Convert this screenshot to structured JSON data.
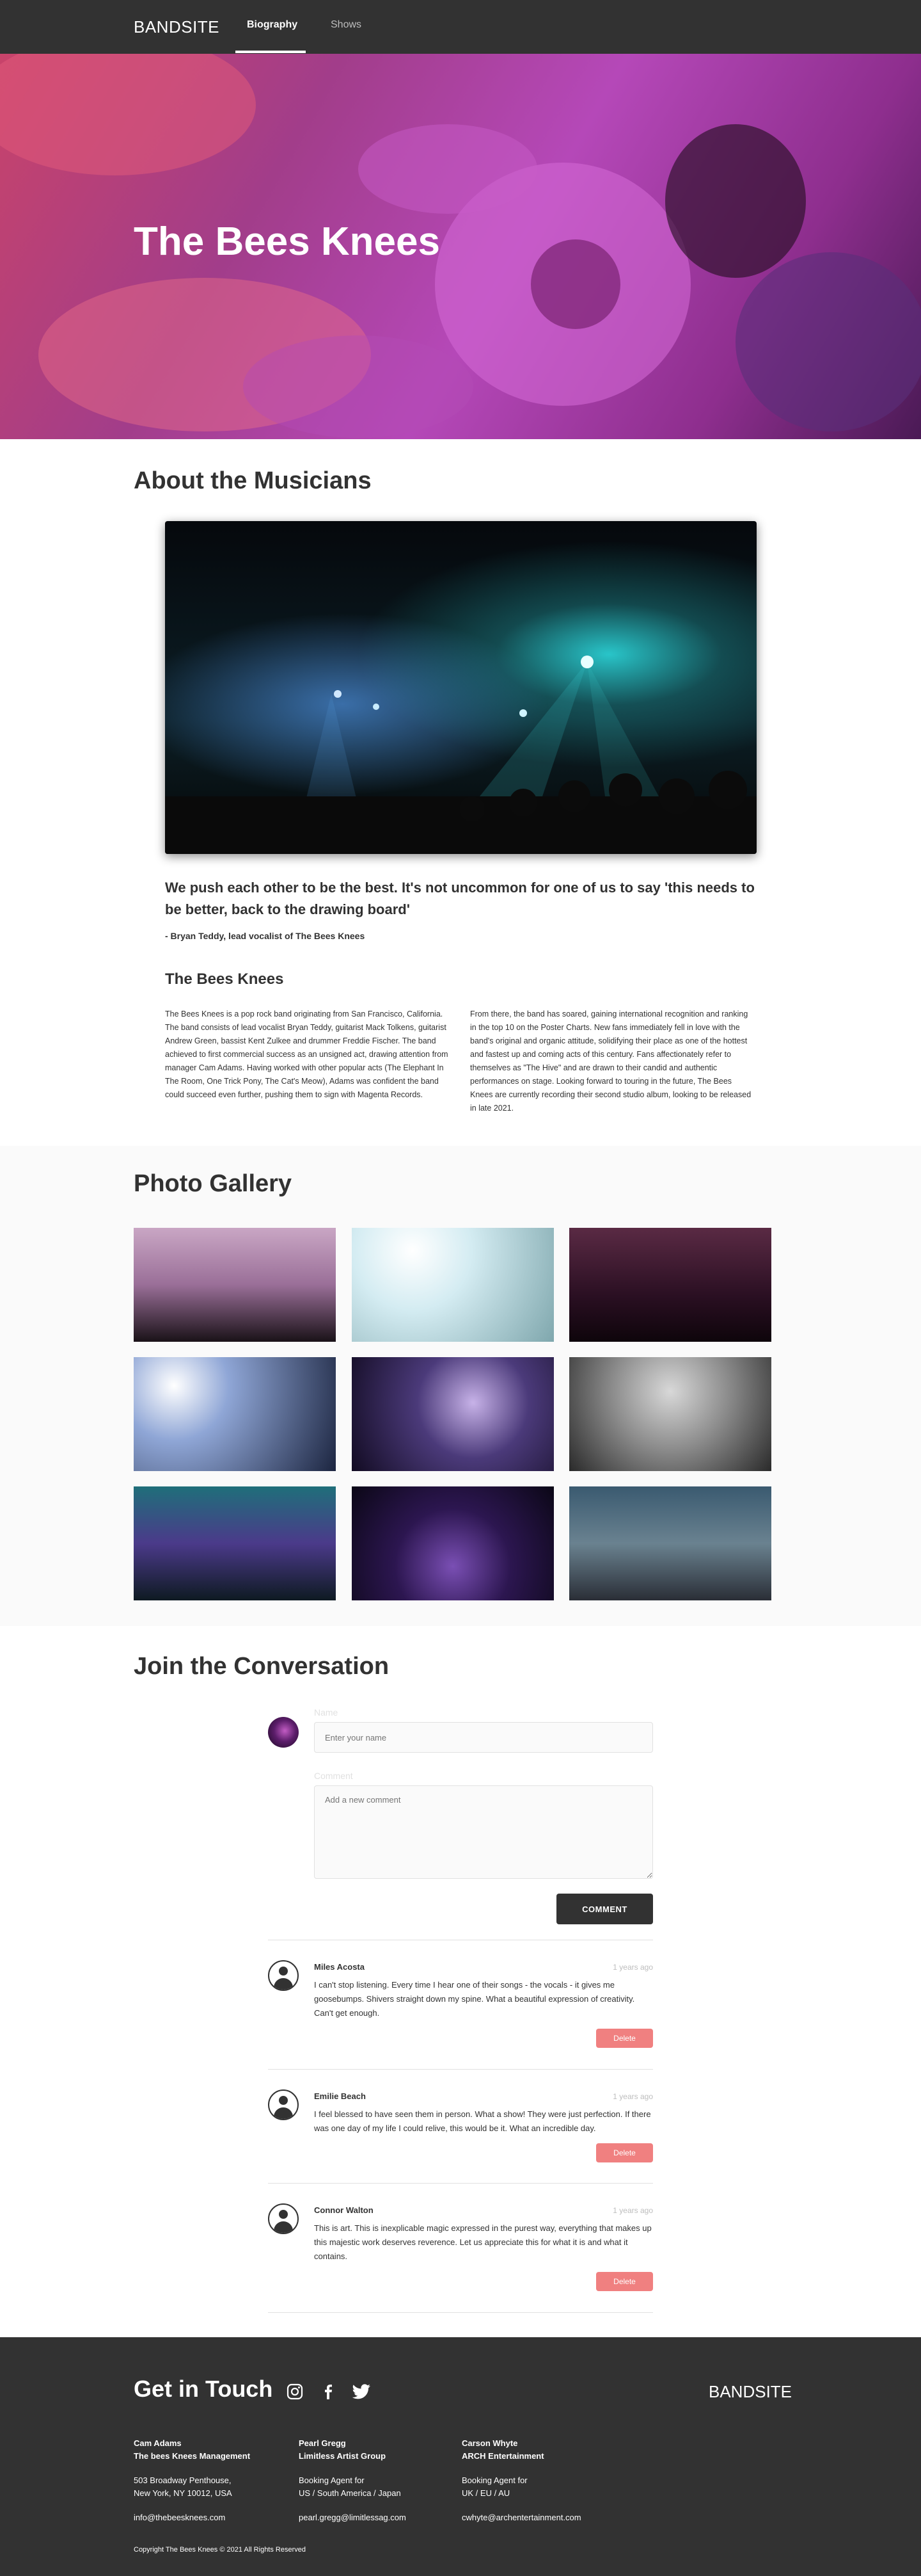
{
  "nav": {
    "brand": "BANDSITE",
    "links": [
      "Biography",
      "Shows"
    ]
  },
  "hero": {
    "title": "The Bees Knees"
  },
  "about": {
    "heading": "About the Musicians",
    "quote": "We push each other to be the best. It's not uncommon for one of us to say 'this needs to be better, back to the drawing board'",
    "cite": "- Bryan Teddy, lead vocalist of The Bees Knees",
    "subheading": "The Bees Knees",
    "para1": "The Bees Knees is a pop rock band originating from San Francisco, California. The band consists of lead vocalist Bryan Teddy, guitarist Mack Tolkens, guitarist Andrew Green, bassist Kent Zulkee and drummer Freddie Fischer. The band achieved to first commercial success as an unsigned act, drawing attention from manager Cam Adams. Having worked with other popular acts (The Elephant In The Room, One Trick Pony, The Cat's Meow), Adams was confident the band could succeed even further, pushing them to sign with Magenta Records.",
    "para2": "From there, the band has soared, gaining international recognition and ranking in the top 10 on the Poster Charts. New fans immediately fell in love with the band's original and organic attitude, solidifying their place as one of the hottest and fastest up and coming acts of this century. Fans affectionately refer to themselves as \"The Hive\" and are drawn to their candid and authentic performances on stage. Looking forward to touring in the future, The Bees Knees are currently recording their second studio album, looking to be released in late 2021."
  },
  "gallery": {
    "heading": "Photo Gallery",
    "photos": 9
  },
  "conversation": {
    "heading": "Join the Conversation",
    "name_label": "Name",
    "name_placeholder": "Enter your name",
    "comment_label": "Comment",
    "comment_placeholder": "Add a new comment",
    "submit_label": "COMMENT",
    "comments": [
      {
        "name": "Miles Acosta",
        "date": "1 years ago",
        "text": "I can't stop listening. Every time I hear one of their songs - the vocals - it gives me goosebumps. Shivers straight down my spine. What a beautiful expression of creativity. Can't get enough.",
        "delete": "Delete"
      },
      {
        "name": "Emilie Beach",
        "date": "1 years ago",
        "text": "I feel blessed to have seen them in person. What a show! They were just perfection. If there was one day of my life I could relive, this would be it. What an incredible day.",
        "delete": "Delete"
      },
      {
        "name": "Connor Walton",
        "date": "1 years ago",
        "text": "This is art. This is inexplicable magic expressed in the purest way, everything that makes up this majestic work deserves reverence. Let us appreciate this for what it is and what it contains.",
        "delete": "Delete"
      }
    ]
  },
  "footer": {
    "title": "Get in Touch",
    "brand": "BANDSITE",
    "contacts": [
      {
        "name": "Cam Adams",
        "org": "The bees Knees Management",
        "line1": "503 Broadway Penthouse,",
        "line2": "New York, NY 10012, USA",
        "email": "info@thebeesknees.com"
      },
      {
        "name": "Pearl Gregg",
        "org": "Limitless Artist Group",
        "line1": "Booking Agent for",
        "line2": "US / South America / Japan",
        "email": "pearl.gregg@limitlessag.com"
      },
      {
        "name": "Carson Whyte",
        "org": "ARCH Entertainment",
        "line1": "Booking Agent for",
        "line2": "UK / EU / AU",
        "email": "cwhyte@archentertainment.com"
      }
    ],
    "copyright": "Copyright The Bees Knees © 2021 All Rights Reserved"
  }
}
